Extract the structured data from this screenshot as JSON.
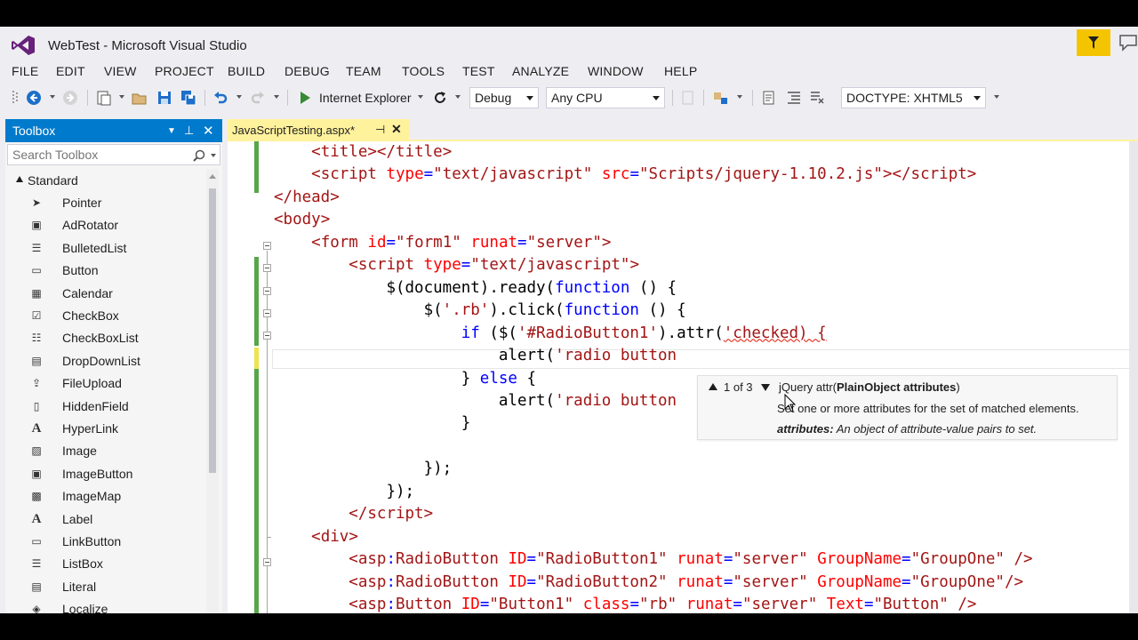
{
  "window": {
    "title": "WebTest - Microsoft Visual Studio"
  },
  "menu": [
    "FILE",
    "EDIT",
    "VIEW",
    "PROJECT",
    "BUILD",
    "DEBUG",
    "TEAM",
    "TOOLS",
    "TEST",
    "ANALYZE",
    "WINDOW",
    "HELP"
  ],
  "toolbar": {
    "run_target": "Internet Explorer",
    "configuration": "Debug",
    "platform": "Any CPU",
    "doctype": "DOCTYPE: XHTML5"
  },
  "toolbox": {
    "title": "Toolbox",
    "search_placeholder": "Search Toolbox",
    "group": "Standard",
    "items": [
      {
        "label": "Pointer",
        "icon": "pointer-icon"
      },
      {
        "label": "AdRotator",
        "icon": "adrotator-icon"
      },
      {
        "label": "BulletedList",
        "icon": "bulleted-list-icon"
      },
      {
        "label": "Button",
        "icon": "button-icon"
      },
      {
        "label": "Calendar",
        "icon": "calendar-icon"
      },
      {
        "label": "CheckBox",
        "icon": "checkbox-icon"
      },
      {
        "label": "CheckBoxList",
        "icon": "checkbox-list-icon"
      },
      {
        "label": "DropDownList",
        "icon": "dropdown-list-icon"
      },
      {
        "label": "FileUpload",
        "icon": "file-upload-icon"
      },
      {
        "label": "HiddenField",
        "icon": "hidden-field-icon"
      },
      {
        "label": "HyperLink",
        "icon": "hyperlink-icon"
      },
      {
        "label": "Image",
        "icon": "image-icon"
      },
      {
        "label": "ImageButton",
        "icon": "image-button-icon"
      },
      {
        "label": "ImageMap",
        "icon": "image-map-icon"
      },
      {
        "label": "Label",
        "icon": "label-icon"
      },
      {
        "label": "LinkButton",
        "icon": "link-button-icon"
      },
      {
        "label": "ListBox",
        "icon": "listbox-icon"
      },
      {
        "label": "Literal",
        "icon": "literal-icon"
      },
      {
        "label": "Localize",
        "icon": "localize-icon"
      }
    ]
  },
  "document_tab": {
    "label": "JavaScriptTesting.aspx*"
  },
  "code_lines": [
    {
      "indent": "    ",
      "tokens": [
        [
          "t",
          "<"
        ],
        [
          "t",
          "title"
        ],
        [
          "t",
          "></"
        ],
        [
          "t",
          "title"
        ],
        [
          "t",
          ">"
        ]
      ]
    },
    {
      "indent": "    ",
      "tokens": [
        [
          "t",
          "<"
        ],
        [
          "t",
          "script"
        ],
        [
          "x",
          " "
        ],
        [
          "a",
          "type"
        ],
        [
          "d",
          "="
        ],
        [
          "s",
          "\"text/javascript\""
        ],
        [
          "x",
          " "
        ],
        [
          "a",
          "src"
        ],
        [
          "d",
          "="
        ],
        [
          "s",
          "\"Scripts/jquery-1.10.2.js\""
        ],
        [
          "t",
          "></"
        ],
        [
          "t",
          "script"
        ],
        [
          "t",
          ">"
        ]
      ]
    },
    {
      "indent": "",
      "tokens": [
        [
          "t",
          "</"
        ],
        [
          "t",
          "head"
        ],
        [
          "t",
          ">"
        ]
      ]
    },
    {
      "indent": "",
      "tokens": [
        [
          "t",
          "<"
        ],
        [
          "t",
          "body"
        ],
        [
          "t",
          ">"
        ]
      ]
    },
    {
      "indent": "    ",
      "tokens": [
        [
          "t",
          "<"
        ],
        [
          "t",
          "form"
        ],
        [
          "x",
          " "
        ],
        [
          "a",
          "id"
        ],
        [
          "d",
          "="
        ],
        [
          "s",
          "\"form1\""
        ],
        [
          "x",
          " "
        ],
        [
          "a",
          "runat"
        ],
        [
          "d",
          "="
        ],
        [
          "s",
          "\"server\""
        ],
        [
          "t",
          ">"
        ]
      ]
    },
    {
      "indent": "        ",
      "tokens": [
        [
          "t",
          "<"
        ],
        [
          "t",
          "script"
        ],
        [
          "x",
          " "
        ],
        [
          "a",
          "type"
        ],
        [
          "d",
          "="
        ],
        [
          "s",
          "\"text/javascript\""
        ],
        [
          "t",
          ">"
        ]
      ]
    },
    {
      "indent": "            ",
      "tokens": [
        [
          "x",
          "$(document).ready("
        ],
        [
          "k",
          "function"
        ],
        [
          "x",
          " () {"
        ]
      ]
    },
    {
      "indent": "                ",
      "tokens": [
        [
          "x",
          "$("
        ],
        [
          "s",
          "'.rb'"
        ],
        [
          "x",
          ").click("
        ],
        [
          "k",
          "function"
        ],
        [
          "x",
          " () {"
        ]
      ]
    },
    {
      "indent": "                    ",
      "tokens": [
        [
          "k",
          "if"
        ],
        [
          "x",
          " ($("
        ],
        [
          "s",
          "'#RadioButton1'"
        ],
        [
          "x",
          ").attr("
        ],
        [
          "sq",
          "'checked) {"
        ]
      ]
    },
    {
      "indent": "                        ",
      "tokens": [
        [
          "x",
          "alert("
        ],
        [
          "s",
          "'radio button"
        ]
      ]
    },
    {
      "indent": "                    ",
      "tokens": [
        [
          "x",
          "} "
        ],
        [
          "k",
          "else"
        ],
        [
          "x",
          " {"
        ]
      ]
    },
    {
      "indent": "                        ",
      "tokens": [
        [
          "x",
          "alert("
        ],
        [
          "s",
          "'radio button"
        ]
      ]
    },
    {
      "indent": "                    ",
      "tokens": [
        [
          "x",
          "}"
        ]
      ]
    },
    {
      "indent": "",
      "tokens": [
        [
          "x",
          ""
        ]
      ]
    },
    {
      "indent": "                ",
      "tokens": [
        [
          "x",
          "});"
        ]
      ]
    },
    {
      "indent": "            ",
      "tokens": [
        [
          "x",
          "});"
        ]
      ]
    },
    {
      "indent": "        ",
      "tokens": [
        [
          "t",
          "</"
        ],
        [
          "t",
          "script"
        ],
        [
          "t",
          ">"
        ]
      ]
    },
    {
      "indent": "    ",
      "tokens": [
        [
          "t",
          "<"
        ],
        [
          "t",
          "div"
        ],
        [
          "t",
          ">"
        ]
      ]
    },
    {
      "indent": "        ",
      "tokens": [
        [
          "t",
          "<"
        ],
        [
          "t",
          "asp"
        ],
        [
          "d",
          ":"
        ],
        [
          "t",
          "RadioButton"
        ],
        [
          "x",
          " "
        ],
        [
          "a",
          "ID"
        ],
        [
          "d",
          "="
        ],
        [
          "s",
          "\"RadioButton1\""
        ],
        [
          "x",
          " "
        ],
        [
          "a",
          "runat"
        ],
        [
          "d",
          "="
        ],
        [
          "s",
          "\"server\""
        ],
        [
          "x",
          " "
        ],
        [
          "a",
          "GroupName"
        ],
        [
          "d",
          "="
        ],
        [
          "s",
          "\"GroupOne\""
        ],
        [
          "x",
          " "
        ],
        [
          "t",
          "/>"
        ]
      ]
    },
    {
      "indent": "        ",
      "tokens": [
        [
          "t",
          "<"
        ],
        [
          "t",
          "asp"
        ],
        [
          "d",
          ":"
        ],
        [
          "t",
          "RadioButton"
        ],
        [
          "x",
          " "
        ],
        [
          "a",
          "ID"
        ],
        [
          "d",
          "="
        ],
        [
          "s",
          "\"RadioButton2\""
        ],
        [
          "x",
          " "
        ],
        [
          "a",
          "runat"
        ],
        [
          "d",
          "="
        ],
        [
          "s",
          "\"server\""
        ],
        [
          "x",
          " "
        ],
        [
          "a",
          "GroupName"
        ],
        [
          "d",
          "="
        ],
        [
          "s",
          "\"GroupOne\""
        ],
        [
          "t",
          "/>"
        ]
      ]
    },
    {
      "indent": "        ",
      "tokens": [
        [
          "t",
          "<"
        ],
        [
          "t",
          "asp"
        ],
        [
          "d",
          ":"
        ],
        [
          "t",
          "Button"
        ],
        [
          "x",
          " "
        ],
        [
          "a",
          "ID"
        ],
        [
          "d",
          "="
        ],
        [
          "s",
          "\"Button1\""
        ],
        [
          "x",
          " "
        ],
        [
          "a",
          "class"
        ],
        [
          "d",
          "="
        ],
        [
          "s",
          "\"rb\""
        ],
        [
          "x",
          " "
        ],
        [
          "a",
          "runat"
        ],
        [
          "d",
          "="
        ],
        [
          "s",
          "\"server\""
        ],
        [
          "x",
          " "
        ],
        [
          "a",
          "Text"
        ],
        [
          "d",
          "="
        ],
        [
          "s",
          "\"Button\""
        ],
        [
          "x",
          " "
        ],
        [
          "t",
          "/>"
        ]
      ]
    }
  ],
  "parameter_info": {
    "counter": "1 of 3",
    "signature_prefix": "jQuery attr(",
    "signature_param": "PlainObject attributes",
    "signature_suffix": ")",
    "description": "Set one or more attributes for the set of matched elements.",
    "param_name": "attributes:",
    "param_desc": " An object of attribute-value pairs to set."
  },
  "colors": {
    "accent": "#007ACC",
    "active_tab": "#FFF29D",
    "changed_line": "#57A64A",
    "unsaved_line": "#EFE34F",
    "notification": "#F5C400"
  }
}
